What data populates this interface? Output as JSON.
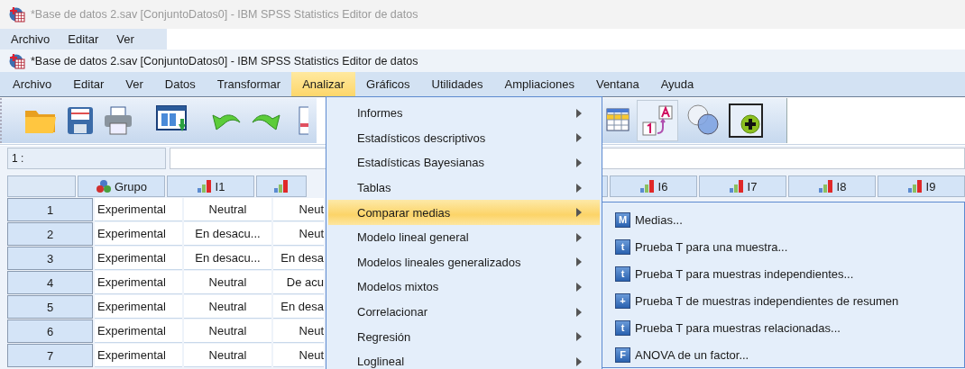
{
  "background_window": {
    "title": "*Base de datos 2.sav [ConjuntoDatos0] - IBM SPSS Statistics Editor de datos",
    "menu": [
      "Archivo",
      "Editar",
      "Ver"
    ]
  },
  "window": {
    "title": "*Base de datos 2.sav [ConjuntoDatos0] - IBM SPSS Statistics Editor de datos"
  },
  "menu_bar": [
    {
      "label": "Archivo",
      "selected": false
    },
    {
      "label": "Editar",
      "selected": false
    },
    {
      "label": "Ver",
      "selected": false
    },
    {
      "label": "Datos",
      "selected": false
    },
    {
      "label": "Transformar",
      "selected": false
    },
    {
      "label": "Analizar",
      "selected": true
    },
    {
      "label": "Gráficos",
      "selected": false
    },
    {
      "label": "Utilidades",
      "selected": false
    },
    {
      "label": "Ampliaciones",
      "selected": false
    },
    {
      "label": "Ventana",
      "selected": false
    },
    {
      "label": "Ayuda",
      "selected": false
    }
  ],
  "cell_editor": {
    "cell_ref": "1 :"
  },
  "grid": {
    "left_columns": [
      {
        "kind": "nominal",
        "name": "Grupo"
      },
      {
        "kind": "ordinal",
        "name": "I1"
      },
      {
        "kind": "ordinal"
      }
    ],
    "right_columns": [
      {
        "kind": "blank"
      },
      {
        "kind": "ordinal",
        "name": "I6"
      },
      {
        "kind": "ordinal",
        "name": "I7"
      },
      {
        "kind": "ordinal",
        "name": "I8"
      },
      {
        "kind": "ordinal",
        "name": "I9"
      }
    ],
    "rows": [
      {
        "number": "1",
        "cells": [
          "Experimental",
          "Neutral",
          "Neut"
        ]
      },
      {
        "number": "2",
        "cells": [
          "Experimental",
          "En desacu...",
          "Neut"
        ]
      },
      {
        "number": "3",
        "cells": [
          "Experimental",
          "En desacu...",
          "En desa"
        ]
      },
      {
        "number": "4",
        "cells": [
          "Experimental",
          "Neutral",
          "De acu"
        ]
      },
      {
        "number": "5",
        "cells": [
          "Experimental",
          "Neutral",
          "En desa"
        ]
      },
      {
        "number": "6",
        "cells": [
          "Experimental",
          "Neutral",
          "Neut"
        ]
      },
      {
        "number": "7",
        "cells": [
          "Experimental",
          "Neutral",
          "Neut"
        ]
      }
    ]
  },
  "analyze_menu": [
    {
      "label": "Informes",
      "selected": false,
      "has_submenu": true
    },
    {
      "label": "Estadísticos descriptivos",
      "selected": false,
      "has_submenu": true
    },
    {
      "label": "Estadísticas Bayesianas",
      "selected": false,
      "has_submenu": true
    },
    {
      "label": "Tablas",
      "selected": false,
      "has_submenu": true
    },
    {
      "label": "Comparar medias",
      "selected": true,
      "has_submenu": true
    },
    {
      "label": "Modelo lineal general",
      "selected": false,
      "has_submenu": true
    },
    {
      "label": "Modelos lineales generalizados",
      "selected": false,
      "has_submenu": true
    },
    {
      "label": "Modelos mixtos",
      "selected": false,
      "has_submenu": true
    },
    {
      "label": "Correlacionar",
      "selected": false,
      "has_submenu": true
    },
    {
      "label": "Regresión",
      "selected": false,
      "has_submenu": true
    },
    {
      "label": "Loglineal",
      "selected": false,
      "has_submenu": true
    }
  ],
  "compare_means_submenu": [
    {
      "label": "Medias...",
      "glyph": "M"
    },
    {
      "label": "Prueba T para una muestra...",
      "glyph": "t"
    },
    {
      "label": "Prueba T para muestras independientes...",
      "glyph": "t"
    },
    {
      "label": "Prueba T de muestras independientes de resumen",
      "glyph": "+"
    },
    {
      "label": "Prueba T para muestras relacionadas...",
      "glyph": "t"
    },
    {
      "label": "ANOVA de un factor...",
      "glyph": "F"
    }
  ]
}
